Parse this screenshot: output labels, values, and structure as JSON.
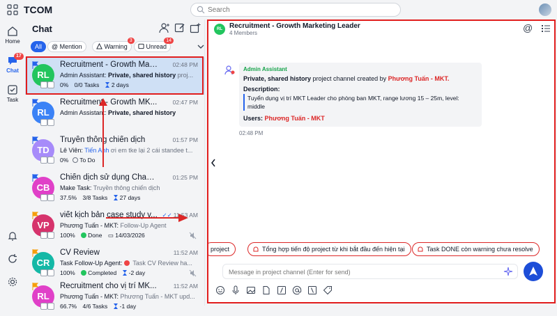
{
  "app": {
    "brand": "TCOM"
  },
  "search": {
    "placeholder": "Search"
  },
  "rail": {
    "home": "Home",
    "chat": "Chat",
    "chat_badge": "17",
    "task": "Task"
  },
  "chatlist": {
    "title": "Chat",
    "filters": [
      {
        "label": "All",
        "badge": ""
      },
      {
        "label": "@ Mention",
        "badge": ""
      },
      {
        "label": "Warning",
        "badge": "3"
      },
      {
        "label": "Unread",
        "badge": "14"
      }
    ],
    "items": [
      {
        "avatar": "RL",
        "name": "Recruitment - Growth Mar...",
        "time": "02:48 PM",
        "preview_sender": "Admin Assistant:",
        "preview_bold": "Private, shared history",
        "preview_rest": " proj...",
        "progress": "0%",
        "tasks": "0/0 Tasks",
        "due": "2 days"
      },
      {
        "avatar": "RL",
        "name": "Recruitment - Growth MK...",
        "time": "02:47 PM",
        "preview_sender": "Admin Assistant:",
        "preview_bold": "Private, shared history",
        "preview_rest": "",
        "progress": "",
        "tasks": "",
        "due": ""
      },
      {
        "avatar": "TD",
        "name": "Truyền thông chiến dịch",
        "time": "01:57 PM",
        "preview_sender": "Lê Viên:",
        "preview_mention": "Tiến Anh",
        "preview_rest": " ơi em tke lại 2 cái standee t...",
        "status": "To Do"
      },
      {
        "avatar": "CB",
        "name": "Chiến dịch sử dụng ChaTa...",
        "time": "01:25 PM",
        "preview_sender": "Make Task:",
        "preview_rest": " Truyền thông chiến dịch",
        "progress": "37.5%",
        "tasks": "3/8 Tasks",
        "due": "27 days"
      },
      {
        "avatar": "VP",
        "name": "viết kịch bản case study v...",
        "time": "11:53 AM",
        "preview_sender": "Phương Tuấn - MKT:",
        "preview_rest": " Follow-Up Agent",
        "progress": "100%",
        "status": "Done",
        "date": "14/03/2026"
      },
      {
        "avatar": "CR",
        "name": "CV Review",
        "time": "11:52 AM",
        "preview_sender": "Task Follow-Up Agent:",
        "preview_rest": " Task CV Review ha...",
        "progress": "100%",
        "status": "Completed",
        "due": "-2 day"
      },
      {
        "avatar": "RL",
        "name": "Recruitment cho vị trí MK...",
        "time": "11:52 AM",
        "preview_sender": "Phương Tuấn - MKT:",
        "preview_rest": " Phương Tuấn - MKT upd...",
        "progress": "66.7%",
        "tasks": "4/6 Tasks",
        "due": "-1 day"
      }
    ]
  },
  "channel": {
    "avatar": "RL",
    "title": "Recruitment - Growth Marketing Leader",
    "members": "4 Members",
    "message": {
      "sender": "Admin Assistant",
      "line_bold": "Private, shared history",
      "line_rest": " project channel created by ",
      "creator": "Phương Tuấn - MKT.",
      "desc_label": "Description:",
      "desc": "Tuyển dụng vị trí MKT Leader cho phòng ban MKT, range lương 15 – 25m, level: middle",
      "users_label": "Users: ",
      "users": "Phương Tuấn - MKT",
      "time": "02:48 PM"
    },
    "suggestions": [
      "project",
      "Tổng hợp tiến độ project từ khi bắt đầu đến hiện tại",
      "Task DONE còn warning chưa resolve"
    ],
    "composer_placeholder": "Message in project channel (Enter for send)"
  },
  "colors": {
    "accent": "#2563eb",
    "highlight": "#e11d1d",
    "selected_row": "#cfe0f5"
  }
}
